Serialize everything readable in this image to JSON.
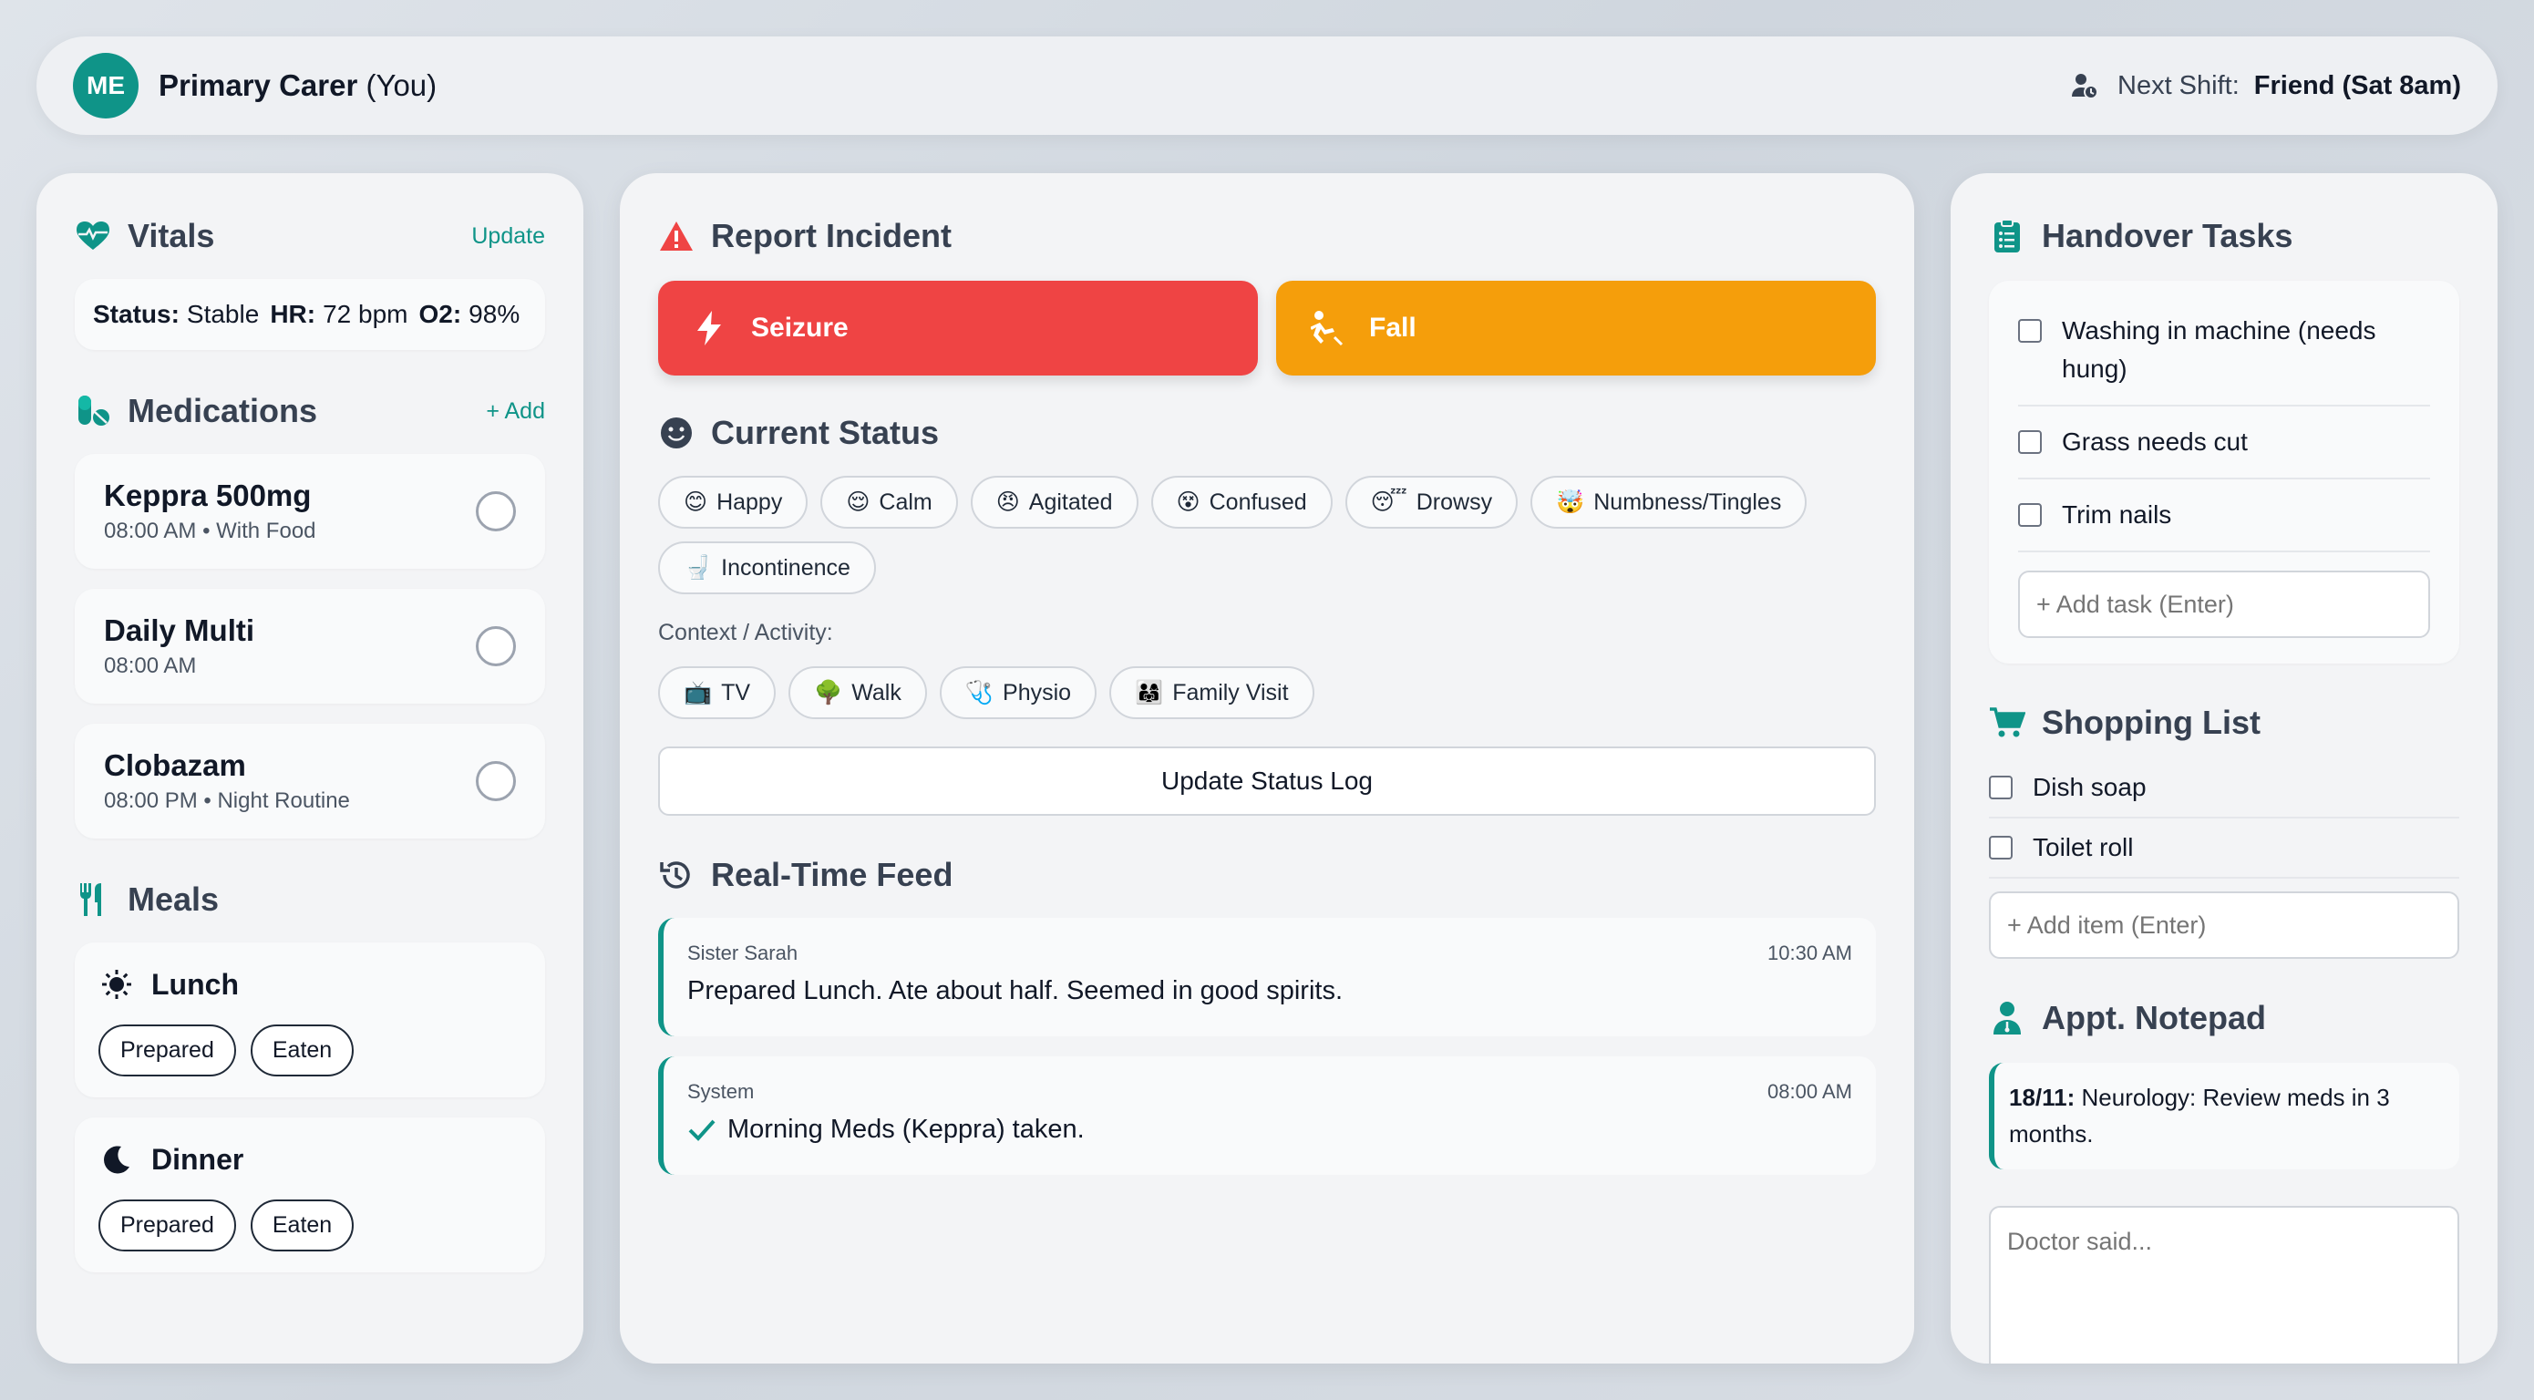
{
  "header": {
    "avatar_initials": "ME",
    "user_name": "Primary Carer",
    "user_suffix": "(You)",
    "shift_label": "Next Shift:",
    "shift_value": "Friend (Sat 8am)"
  },
  "vitals": {
    "title": "Vitals",
    "action": "Update",
    "status_label": "Status:",
    "status_value": "Stable",
    "hr_label": "HR:",
    "hr_value": "72 bpm",
    "o2_label": "O2:",
    "o2_value": "98%"
  },
  "medications": {
    "title": "Medications",
    "action": "+ Add",
    "items": [
      {
        "name": "Keppra 500mg",
        "detail": "08:00 AM • With Food"
      },
      {
        "name": "Daily Multi",
        "detail": "08:00 AM"
      },
      {
        "name": "Clobazam",
        "detail": "08:00 PM • Night Routine"
      }
    ]
  },
  "meals": {
    "title": "Meals",
    "items": [
      {
        "name": "Lunch",
        "prepared": "Prepared",
        "eaten": "Eaten"
      },
      {
        "name": "Dinner",
        "prepared": "Prepared",
        "eaten": "Eaten"
      }
    ]
  },
  "incident": {
    "title": "Report Incident",
    "seizure": "Seizure",
    "fall": "Fall",
    "seizure_color": "#ef4444",
    "fall_color": "#f59e0b"
  },
  "status": {
    "title": "Current Status",
    "moods": [
      {
        "emoji": "😊",
        "label": "Happy"
      },
      {
        "emoji": "😌",
        "label": "Calm"
      },
      {
        "emoji": "😠",
        "label": "Agitated"
      },
      {
        "emoji": "😵",
        "label": "Confused"
      },
      {
        "emoji": "😴",
        "label": "Drowsy"
      },
      {
        "emoji": "🤯",
        "label": "Numbness/Tingles"
      },
      {
        "emoji": "🚽",
        "label": "Incontinence"
      }
    ],
    "context_label": "Context / Activity:",
    "activities": [
      {
        "emoji": "📺",
        "label": "TV"
      },
      {
        "emoji": "🌳",
        "label": "Walk"
      },
      {
        "emoji": "🩺",
        "label": "Physio"
      },
      {
        "emoji": "👨‍👩‍👧",
        "label": "Family Visit"
      }
    ],
    "update_button": "Update Status Log"
  },
  "feed": {
    "title": "Real-Time Feed",
    "items": [
      {
        "author": "Sister Sarah",
        "time": "10:30 AM",
        "message": "Prepared Lunch. Ate about half. Seemed in good spirits."
      },
      {
        "author": "System",
        "time": "08:00 AM",
        "message": "Morning Meds (Keppra) taken."
      }
    ]
  },
  "handover": {
    "title": "Handover Tasks",
    "tasks": [
      "Washing in machine (needs hung)",
      "Grass needs cut",
      "Trim nails"
    ],
    "placeholder": "+ Add task (Enter)"
  },
  "shopping": {
    "title": "Shopping List",
    "items": [
      "Dish soap",
      "Toilet roll"
    ],
    "placeholder": "+ Add item (Enter)"
  },
  "appt": {
    "title": "Appt. Notepad",
    "note_date": "18/11:",
    "note_text": "Neurology: Review meds in 3 months.",
    "placeholder": "Doctor said..."
  },
  "colors": {
    "accent": "#0f9488",
    "danger": "#ef4444",
    "warning": "#f59e0b"
  }
}
